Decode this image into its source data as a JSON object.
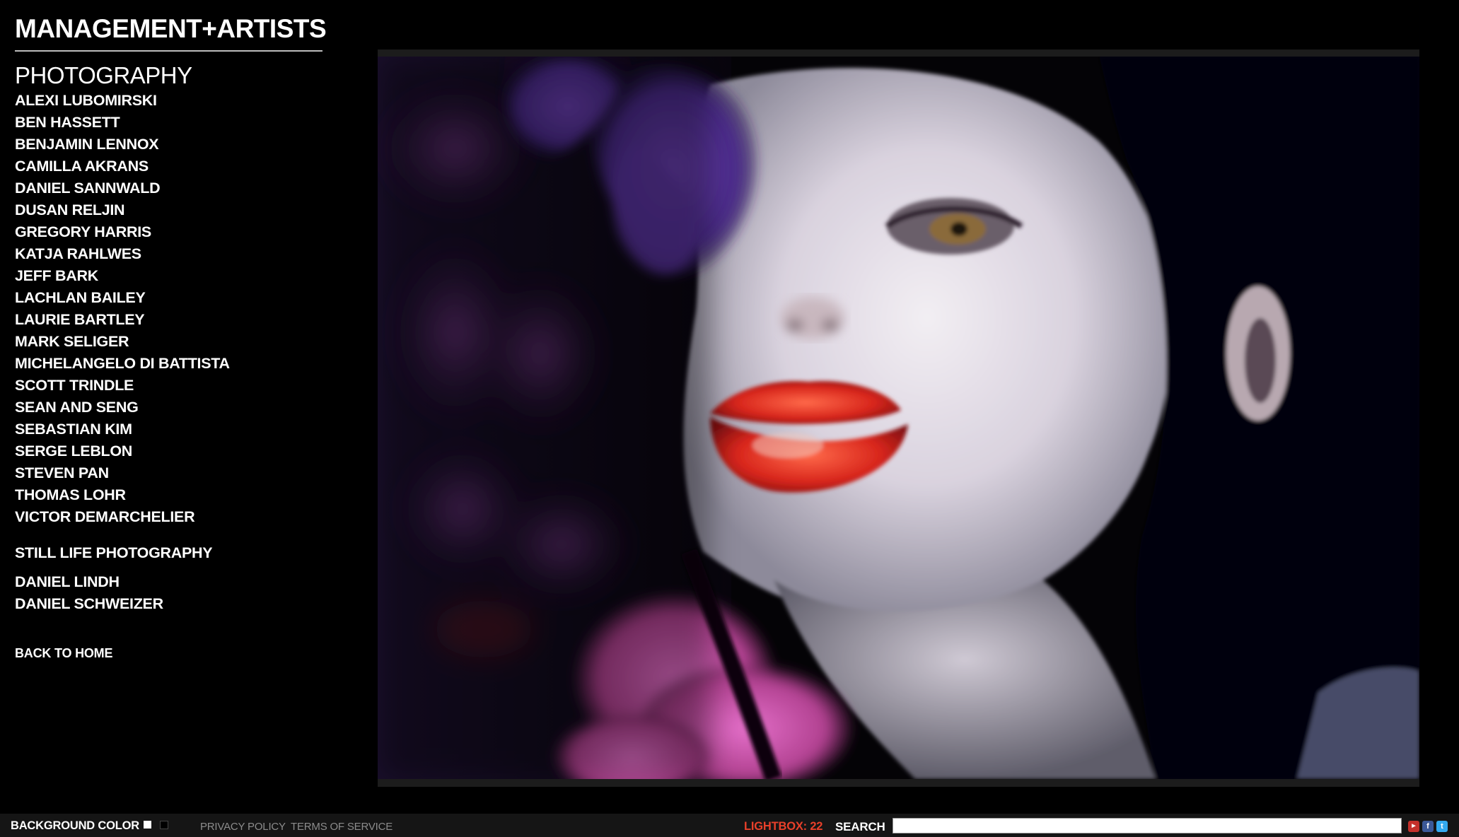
{
  "brand": {
    "logo": "MANAGEMENT+ARTISTS"
  },
  "sidebar": {
    "section_title": "PHOTOGRAPHY",
    "photographers": [
      "ALEXI LUBOMIRSKI",
      "BEN HASSETT",
      "BENJAMIN LENNOX",
      "CAMILLA AKRANS",
      "DANIEL SANNWALD",
      "DUSAN RELJIN",
      "GREGORY HARRIS",
      "KATJA RAHLWES",
      "JEFF BARK",
      "LACHLAN BAILEY",
      "LAURIE BARTLEY",
      "MARK SELIGER",
      "MICHELANGELO DI BATTISTA",
      "SCOTT TRINDLE",
      "SEAN AND SENG",
      "SEBASTIAN KIM",
      "SERGE LEBLON",
      "STEVEN PAN",
      "THOMAS LOHR",
      "VICTOR DEMARCHELIER"
    ],
    "still_life_title": "STILL LIFE PHOTOGRAPHY",
    "still_life": [
      "DANIEL LINDH",
      "DANIEL SCHWEIZER"
    ],
    "back_home": "BACK TO HOME"
  },
  "footer": {
    "background_color_label": "BACKGROUND COLOR",
    "swatches": [
      "#ffffff",
      "#000000"
    ],
    "privacy": "PRIVACY POLICY",
    "terms": "TERMS OF SERVICE",
    "lightbox": "LIGHTBOX: 22",
    "search_label": "SEARCH",
    "search_value": "",
    "social_icons": [
      "youtube-icon",
      "facebook-icon",
      "twitter-icon"
    ]
  },
  "colors": {
    "background": "#000000",
    "text": "#ffffff",
    "lightbox_accent": "#e8402a",
    "footer_bar": "#151515",
    "footer_link": "#8c8c8c"
  }
}
